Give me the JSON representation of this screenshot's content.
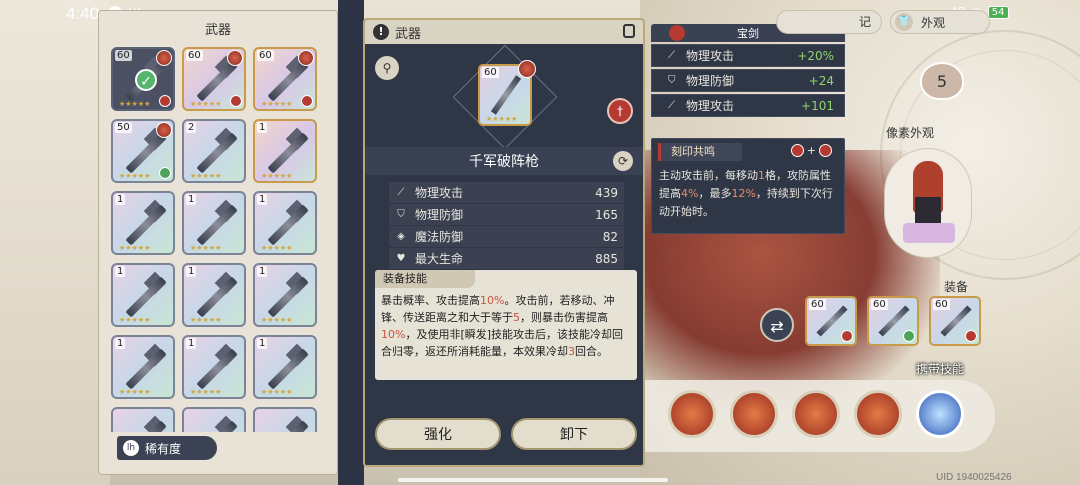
{
  "status_bar": {
    "time": "4:40",
    "signal": "49",
    "battery": "54"
  },
  "weapon_panel": {
    "title": "武器",
    "rarity_button": "稀有度",
    "items": [
      {
        "level": "60",
        "selected": true,
        "gold": false,
        "avatar": true,
        "badge": "red"
      },
      {
        "level": "60",
        "selected": false,
        "gold": true,
        "avatar": true,
        "badge": "red"
      },
      {
        "level": "60",
        "selected": false,
        "gold": true,
        "avatar": true,
        "badge": "red"
      },
      {
        "level": "50",
        "selected": false,
        "gold": false,
        "avatar": true,
        "badge": "green"
      },
      {
        "level": "2",
        "selected": false,
        "gold": false,
        "avatar": false,
        "badge": ""
      },
      {
        "level": "1",
        "selected": false,
        "gold": true,
        "avatar": false,
        "badge": ""
      },
      {
        "level": "1",
        "selected": false,
        "gold": false,
        "avatar": false,
        "badge": ""
      },
      {
        "level": "1",
        "selected": false,
        "gold": false,
        "avatar": false,
        "badge": ""
      },
      {
        "level": "1",
        "selected": false,
        "gold": false,
        "avatar": false,
        "badge": ""
      },
      {
        "level": "1",
        "selected": false,
        "gold": false,
        "avatar": false,
        "badge": ""
      },
      {
        "level": "1",
        "selected": false,
        "gold": false,
        "avatar": false,
        "badge": ""
      },
      {
        "level": "1",
        "selected": false,
        "gold": false,
        "avatar": false,
        "badge": ""
      },
      {
        "level": "1",
        "selected": false,
        "gold": false,
        "avatar": false,
        "badge": ""
      },
      {
        "level": "1",
        "selected": false,
        "gold": false,
        "avatar": false,
        "badge": ""
      },
      {
        "level": "1",
        "selected": false,
        "gold": false,
        "avatar": false,
        "badge": ""
      },
      {
        "level": "",
        "selected": false,
        "gold": false,
        "avatar": false,
        "badge": ""
      },
      {
        "level": "",
        "selected": false,
        "gold": false,
        "avatar": false,
        "badge": ""
      },
      {
        "level": "",
        "selected": false,
        "gold": false,
        "avatar": false,
        "badge": ""
      }
    ]
  },
  "detail": {
    "header": "武器",
    "card_level": "60",
    "weapon_name": "千军破阵枪",
    "stats": [
      {
        "icon": "sword-icon",
        "label": "物理攻击",
        "value": "439"
      },
      {
        "icon": "shield-icon",
        "label": "物理防御",
        "value": "165"
      },
      {
        "icon": "magic-shield-icon",
        "label": "魔法防御",
        "value": "82"
      },
      {
        "icon": "heart-icon",
        "label": "最大生命",
        "value": "885"
      }
    ],
    "skill_title": "装备技能",
    "skill_parts": [
      {
        "t": "暴击概率、攻击提高",
        "hl": false
      },
      {
        "t": "10%",
        "hl": true
      },
      {
        "t": "。攻击前，若移动、冲锋、传送距离之和大于等于",
        "hl": false
      },
      {
        "t": "5",
        "hl": true
      },
      {
        "t": "，则暴击伤害提高",
        "hl": false
      },
      {
        "t": "10%",
        "hl": true
      },
      {
        "t": "，及使用非[瞬发]技能攻击后，该技能冷却回合归零，返还所消耗能量，本效果冷却",
        "hl": false
      },
      {
        "t": "3",
        "hl": true
      },
      {
        "t": "回合。",
        "hl": false
      }
    ],
    "btn_enhance": "强化",
    "btn_unequip": "卸下"
  },
  "treasure": {
    "title": "宝剑",
    "rows": [
      {
        "icon": "sword-icon",
        "label": "物理攻击",
        "value": "+20%"
      },
      {
        "icon": "shield-icon",
        "label": "物理防御",
        "value": "+24"
      },
      {
        "icon": "sword-icon",
        "label": "物理攻击",
        "value": "+101"
      }
    ]
  },
  "resonance": {
    "title": "刻印共鸣",
    "plus": "+",
    "parts": [
      {
        "t": "主动攻击前，每移动",
        "hl": false
      },
      {
        "t": "1",
        "hl": true
      },
      {
        "t": "格，攻防属性提高",
        "hl": false
      },
      {
        "t": "4%",
        "hl": true
      },
      {
        "t": "，最多",
        "hl": false
      },
      {
        "t": "12%",
        "hl": true
      },
      {
        "t": "，持续到下次行动开始时。",
        "hl": false
      }
    ]
  },
  "right": {
    "tab1": "记",
    "tab2": "外观",
    "heart_number": "5",
    "pixel_label": "像素外观",
    "equip_label": "装备",
    "equip_cards": [
      {
        "level": "60",
        "badge": "red"
      },
      {
        "level": "60",
        "badge": "green"
      },
      {
        "level": "60",
        "badge": "red"
      }
    ],
    "skills_label": "携带技能",
    "uid": "UID 1940025426"
  }
}
